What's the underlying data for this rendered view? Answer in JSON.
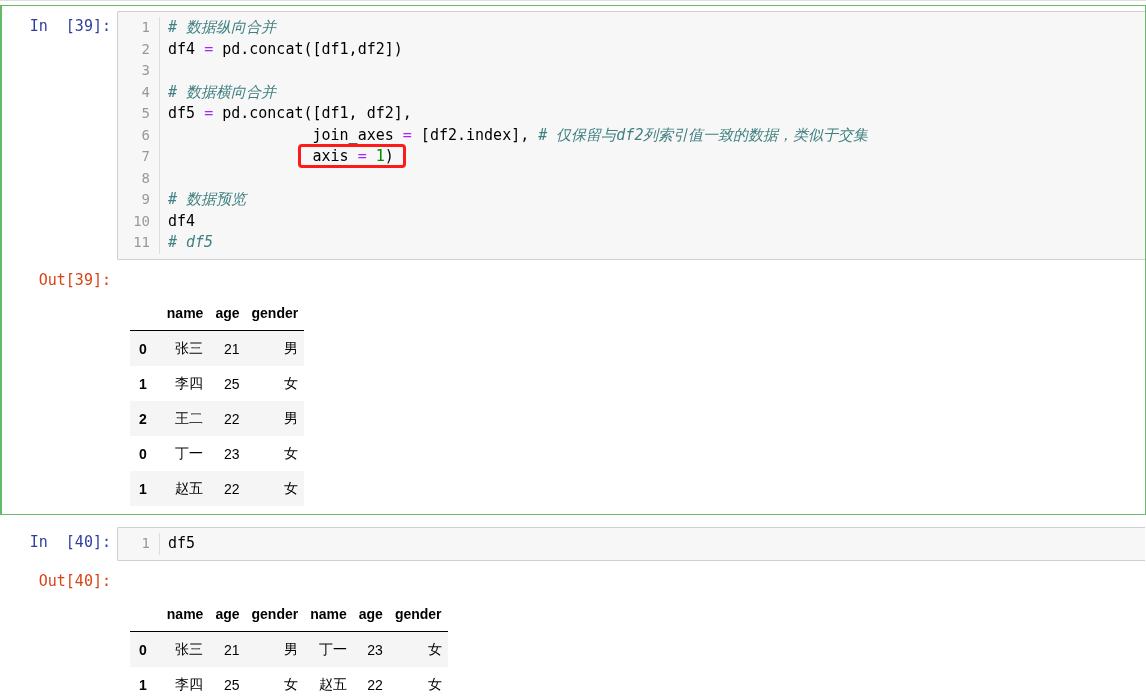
{
  "cells": [
    {
      "selected": true,
      "in_prompt": "In  [39]:",
      "out_prompt": "Out[39]:",
      "lines": [
        {
          "number": "1",
          "tokens": [
            {
              "kind": "comment",
              "text": "# 数据纵向合并"
            }
          ]
        },
        {
          "number": "2",
          "tokens": [
            {
              "kind": "plain",
              "text": "df4 "
            },
            {
              "kind": "op",
              "text": "="
            },
            {
              "kind": "plain",
              "text": " pd.concat([df1,df2])"
            }
          ]
        },
        {
          "number": "3"
        },
        {
          "number": "4",
          "tokens": [
            {
              "kind": "comment",
              "text": "# 数据横向合并"
            }
          ]
        },
        {
          "number": "5",
          "tokens": [
            {
              "kind": "plain",
              "text": "df5 "
            },
            {
              "kind": "op",
              "text": "="
            },
            {
              "kind": "plain",
              "text": " pd.concat([df1, df2],"
            }
          ]
        },
        {
          "number": "6",
          "tokens": [
            {
              "kind": "plain",
              "text": "                join_axes "
            },
            {
              "kind": "op",
              "text": "="
            },
            {
              "kind": "plain",
              "text": " [df2.index], "
            },
            {
              "kind": "comment",
              "text": "# 仅保留与df2列索引值一致的数据，类似于交集"
            }
          ]
        },
        {
          "number": "7",
          "highlighted": true,
          "tokens": [
            {
              "kind": "plain",
              "text": "                axis "
            },
            {
              "kind": "op",
              "text": "="
            },
            {
              "kind": "num",
              "text": " 1"
            },
            {
              "kind": "plain",
              "text": ")"
            }
          ]
        },
        {
          "number": "8"
        },
        {
          "number": "9",
          "tokens": [
            {
              "kind": "comment",
              "text": "# 数据预览"
            }
          ]
        },
        {
          "number": "10",
          "tokens": [
            {
              "kind": "plain",
              "text": "df4"
            }
          ]
        },
        {
          "number": "11",
          "tokens": [
            {
              "kind": "comment",
              "text": "# df5"
            }
          ]
        }
      ],
      "table": {
        "columns": [
          "name",
          "age",
          "gender"
        ],
        "rows": [
          {
            "index": "0",
            "cells": [
              "张三",
              "21",
              "男"
            ]
          },
          {
            "index": "1",
            "cells": [
              "李四",
              "25",
              "女"
            ]
          },
          {
            "index": "2",
            "cells": [
              "王二",
              "22",
              "男"
            ]
          },
          {
            "index": "0",
            "cells": [
              "丁一",
              "23",
              "女"
            ]
          },
          {
            "index": "1",
            "cells": [
              "赵五",
              "22",
              "女"
            ]
          }
        ]
      }
    },
    {
      "selected": false,
      "in_prompt": "In  [40]:",
      "out_prompt": "Out[40]:",
      "lines": [
        {
          "number": "1",
          "tokens": [
            {
              "kind": "plain",
              "text": "df5"
            }
          ]
        }
      ],
      "table": {
        "columns": [
          "name",
          "age",
          "gender",
          "name",
          "age",
          "gender"
        ],
        "rows": [
          {
            "index": "0",
            "cells": [
              "张三",
              "21",
              "男",
              "丁一",
              "23",
              "女"
            ]
          },
          {
            "index": "1",
            "cells": [
              "李四",
              "25",
              "女",
              "赵五",
              "22",
              "女"
            ]
          }
        ]
      }
    }
  ]
}
